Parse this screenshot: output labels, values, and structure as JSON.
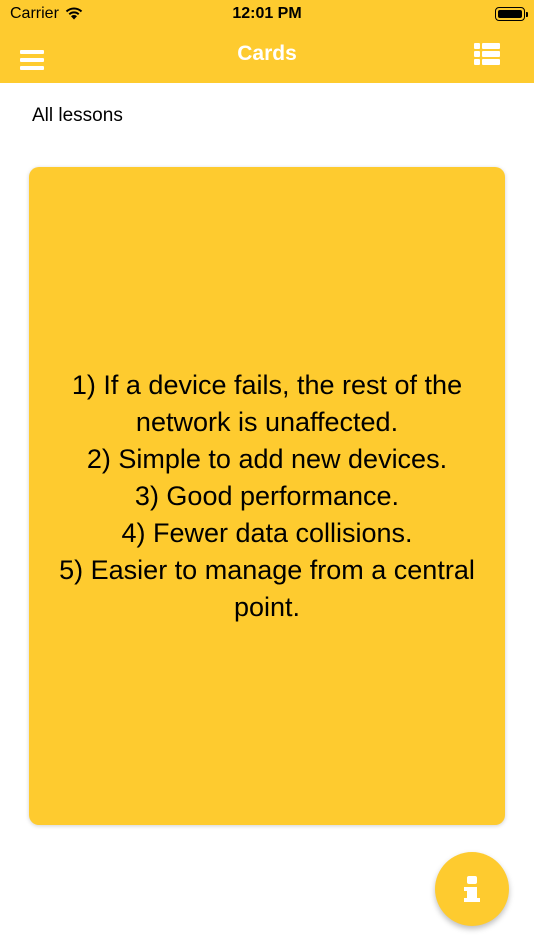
{
  "status_bar": {
    "carrier": "Carrier",
    "time": "12:01 PM"
  },
  "navbar": {
    "title": "Cards",
    "left_icon": "hamburger-menu-icon",
    "right_icon": "list-icon"
  },
  "section": {
    "label": "All lessons"
  },
  "card": {
    "text": "1) If a device fails, the rest of the network is unaffected.\n2) Simple to add new devices.\n3) Good performance.\n4) Fewer data collisions.\n5) Easier to manage from a central point."
  },
  "fab": {
    "icon": "info-icon"
  },
  "colors": {
    "accent": "#fecb2f",
    "on_accent": "#ffffff",
    "text": "#000000",
    "background": "#ffffff"
  }
}
